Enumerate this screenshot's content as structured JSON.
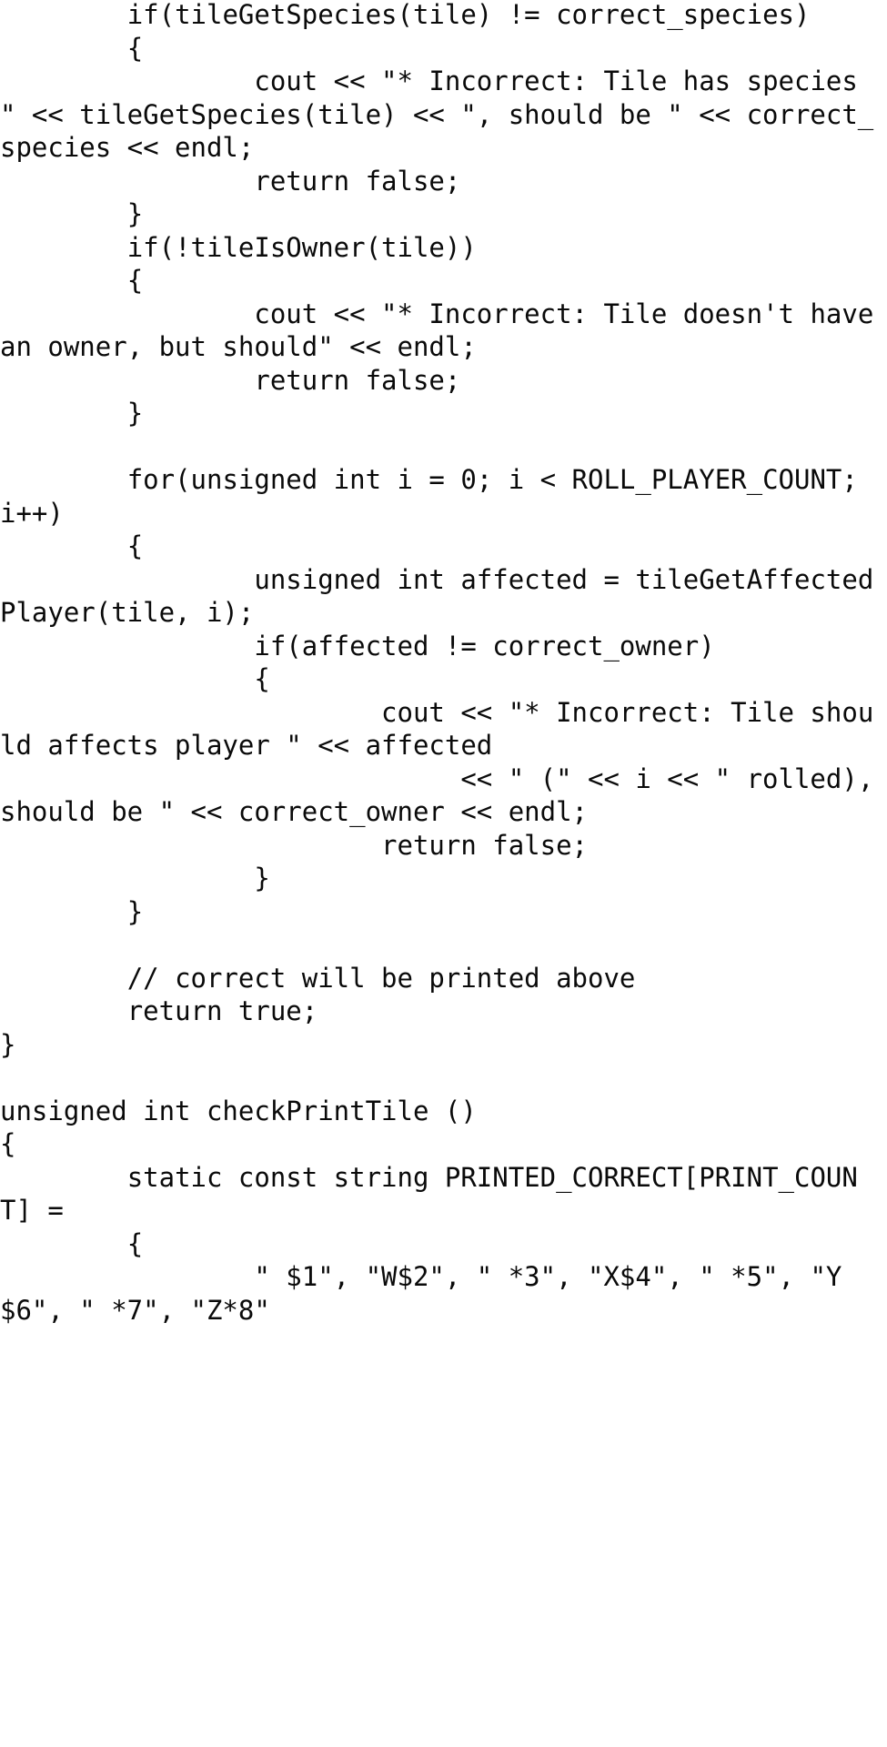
{
  "document": {
    "kind": "plain-text-code-listing",
    "language": "cpp",
    "background_color": "#ffffff",
    "text_color": "#0a0a0a",
    "font_style": "monospace",
    "wrap_columns": 42,
    "tab_width": 8,
    "lines": [
      "        if(tileGetSpecies(tile) != correct_species)",
      "        {",
      "                cout << \"* Incorrect: Tile has species \" << tileGetSpecies(tile) << \", should be \" << correct_species << endl;",
      "                return false;",
      "        }",
      "        if(!tileIsOwner(tile))",
      "        {",
      "                cout << \"* Incorrect: Tile doesn't have an owner, but should\" << endl;",
      "                return false;",
      "        }",
      "",
      "        for(unsigned int i = 0; i < ROLL_PLAYER_COUNT; i++)",
      "        {",
      "                unsigned int affected = tileGetAffectedPlayer(tile, i);",
      "                if(affected != correct_owner)",
      "                {",
      "                        cout << \"* Incorrect: Tile should affects player \" << affected",
      "                             << \" (\" << i << \" rolled), should be \" << correct_owner << endl;",
      "                        return false;",
      "                }",
      "        }",
      "",
      "        // correct will be printed above",
      "        return true;",
      "}",
      "",
      "unsigned int checkPrintTile ()",
      "{",
      "        static const string PRINTED_CORRECT[PRINT_COUNT] =",
      "        {",
      "                \" $1\", \"W$2\", \" *3\", \"X$4\", \" *5\", \"Y$6\", \" *7\", \"Z*8\""
    ],
    "full_text": "        if(tileGetSpecies(tile) != correct_species)\n        {\n                cout << \"* Incorrect: Tile has species \" << tileGetSpecies(tile) << \", should be \" << correct_species << endl;\n                return false;\n        }\n        if(!tileIsOwner(tile))\n        {\n                cout << \"* Incorrect: Tile doesn't have an owner, but should\" << endl;\n                return false;\n        }\n\n        for(unsigned int i = 0; i < ROLL_PLAYER_COUNT; i++)\n        {\n                unsigned int affected = tileGetAffectedPlayer(tile, i);\n                if(affected != correct_owner)\n                {\n                        cout << \"* Incorrect: Tile should affects player \" << affected\n                             << \" (\" << i << \" rolled), should be \" << correct_owner << endl;\n                        return false;\n                }\n        }\n\n        // correct will be printed above\n        return true;\n}\n\nunsigned int checkPrintTile ()\n{\n        static const string PRINTED_CORRECT[PRINT_COUNT] =\n        {\n                \" $1\", \"W$2\", \" *3\", \"X$4\", \" *5\", \"Y$6\", \" *7\", \"Z*8\""
  }
}
